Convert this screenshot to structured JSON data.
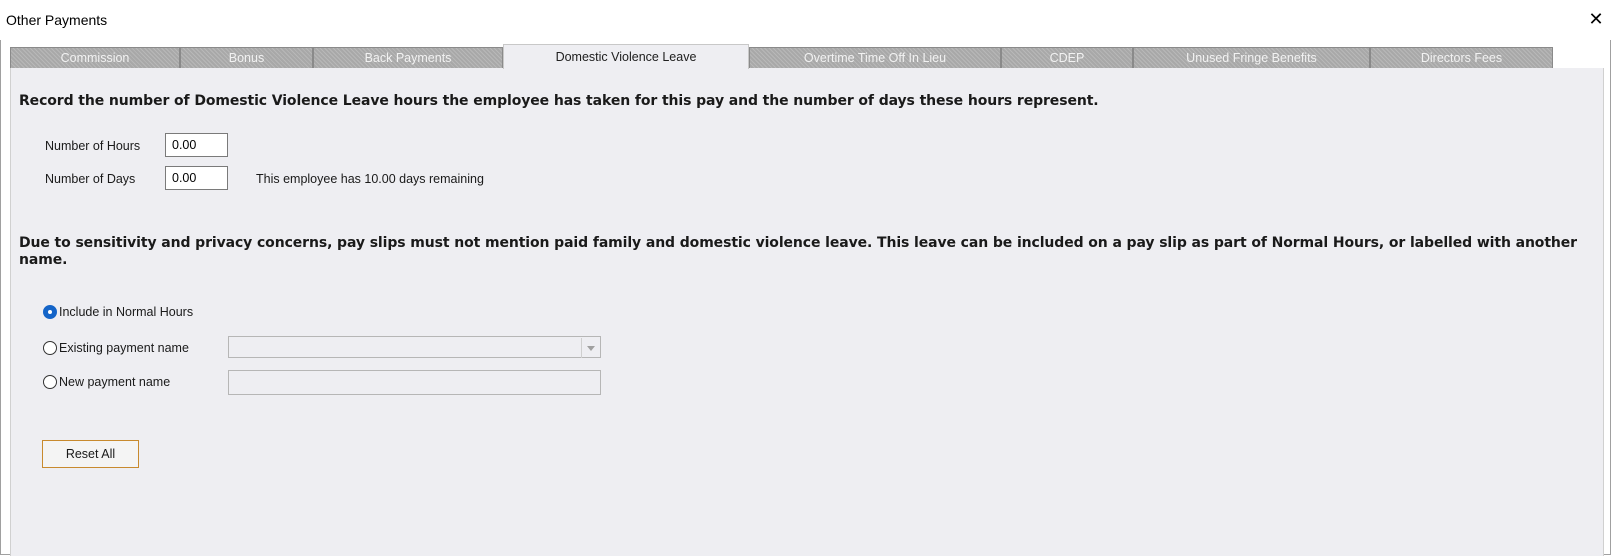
{
  "window": {
    "title": "Other Payments",
    "close_glyph": "✕"
  },
  "tabs": [
    {
      "label": "Commission",
      "active": false
    },
    {
      "label": "Bonus",
      "active": false
    },
    {
      "label": "Back Payments",
      "active": false
    },
    {
      "label": "Domestic Violence Leave",
      "active": true
    },
    {
      "label": "Overtime Time Off In Lieu",
      "active": false
    },
    {
      "label": "CDEP",
      "active": false
    },
    {
      "label": "Unused Fringe Benefits",
      "active": false
    },
    {
      "label": "Directors Fees",
      "active": false
    }
  ],
  "panel": {
    "instruction": "Record the number of Domestic Violence Leave hours the employee has taken for this pay and the number of days these hours represent.",
    "hours_label": "Number of Hours",
    "hours_value": "0.00",
    "days_label": "Number of Days",
    "days_value": "0.00",
    "remaining_text": "This employee has 10.00 days remaining",
    "privacy_notice": "Due to sensitivity and privacy concerns, pay slips must not mention paid family and domestic violence leave. This leave can be included on a pay slip as part of Normal Hours, or labelled with another name.",
    "options": {
      "include_normal": "Include in Normal Hours",
      "existing_name": "Existing payment name",
      "new_name": "New payment name",
      "selected": "include_normal"
    },
    "existing_name_value": "",
    "new_name_value": "",
    "reset_label": "Reset All"
  },
  "colors": {
    "accent": "#1464c8",
    "button_border": "#c88a2e",
    "panel_bg": "#eeeef2",
    "tab_inactive": "#a8a8a8"
  }
}
